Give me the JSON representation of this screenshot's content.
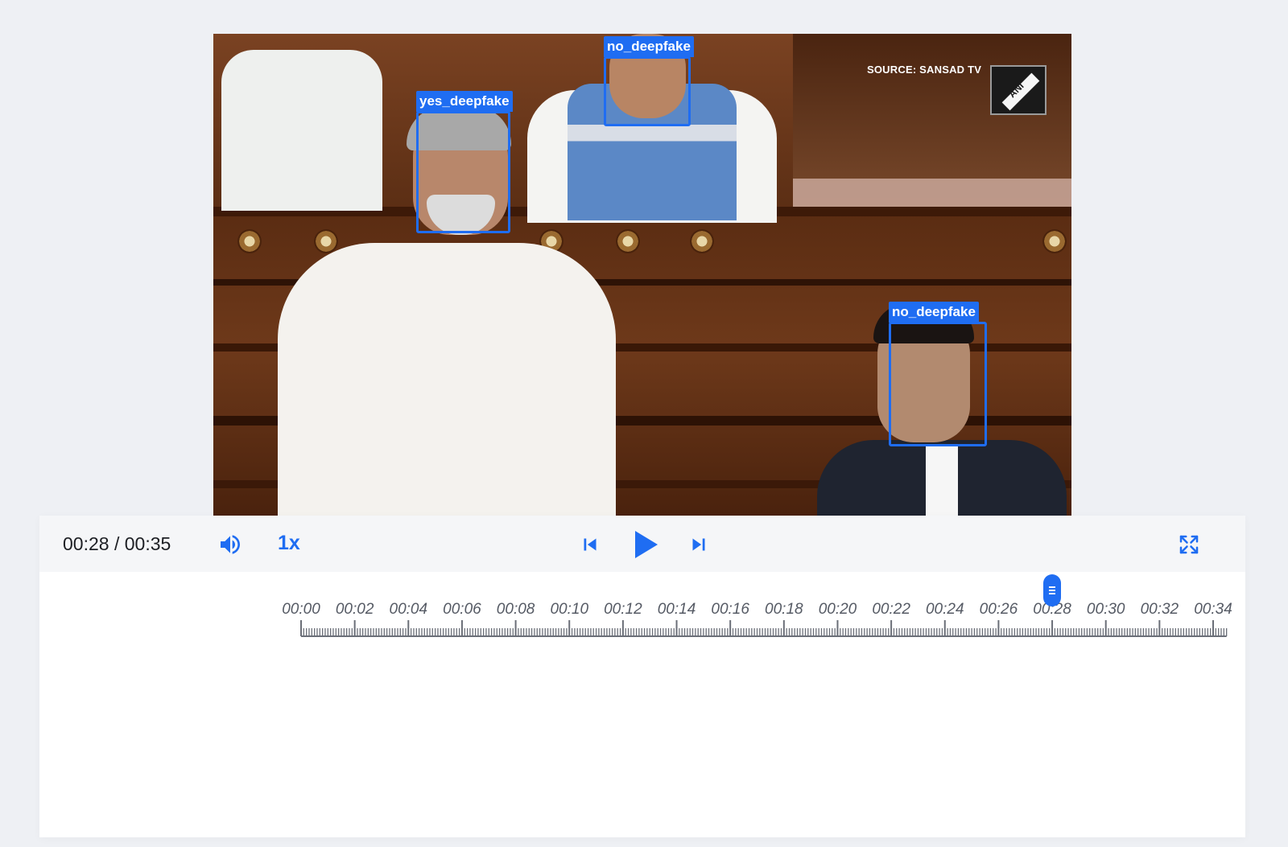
{
  "video": {
    "watermark_source": "SOURCE: SANSAD TV",
    "watermark_logo": "ANI",
    "detections": [
      {
        "label": "yes_deepfake"
      },
      {
        "label": "no_deepfake"
      },
      {
        "label": "no_deepfake"
      }
    ]
  },
  "controls": {
    "current_time": "00:28",
    "duration": "00:35",
    "separator": " / ",
    "speed": "1x",
    "icons": [
      "volume-icon",
      "skip-previous-icon",
      "play-icon",
      "skip-next-icon",
      "fullscreen-icon"
    ],
    "accent_color": "#1f6df2"
  },
  "timeline": {
    "labels": [
      "00:00",
      "00:02",
      "00:04",
      "00:06",
      "00:08",
      "00:10",
      "00:12",
      "00:14",
      "00:16",
      "00:18",
      "00:20",
      "00:22",
      "00:24",
      "00:26",
      "00:28",
      "00:30",
      "00:32",
      "00:34"
    ],
    "playhead_seconds": 28,
    "duration_seconds": 35
  }
}
